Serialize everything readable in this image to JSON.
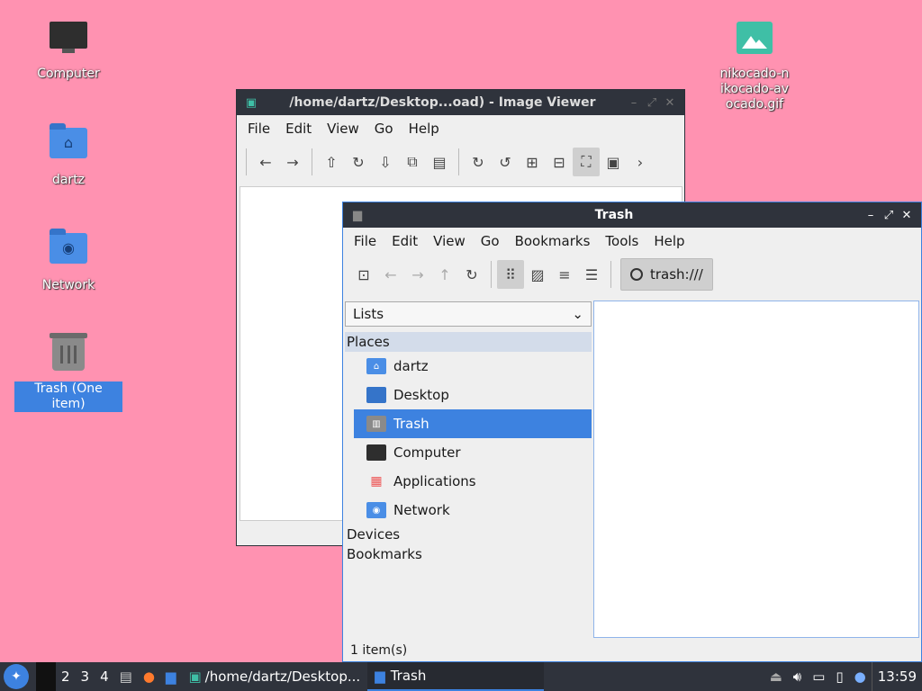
{
  "desktop": {
    "icons": [
      {
        "label": "Computer"
      },
      {
        "label": "dartz"
      },
      {
        "label": "Network"
      },
      {
        "label": "Trash (One item)"
      },
      {
        "label": "nikocado-nikocado-avocado.gif"
      }
    ]
  },
  "viewer": {
    "title": "/home/dartz/Desktop...oad) - Image Viewer",
    "menu": [
      "File",
      "Edit",
      "View",
      "Go",
      "Help"
    ]
  },
  "trash": {
    "title": "Trash",
    "menu": [
      "File",
      "Edit",
      "View",
      "Go",
      "Bookmarks",
      "Tools",
      "Help"
    ],
    "location": "trash:///",
    "side_mode": "Lists",
    "groups": {
      "places": "Places",
      "devices": "Devices",
      "bookmarks": "Bookmarks"
    },
    "places": [
      "dartz",
      "Desktop",
      "Trash",
      "Computer",
      "Applications",
      "Network"
    ],
    "status": "1 item(s)"
  },
  "taskbar": {
    "workspaces": [
      "2",
      "3",
      "4"
    ],
    "tasks": [
      "/home/dartz/Desktop...",
      "Trash"
    ],
    "clock": "13:59"
  },
  "colors": {
    "desktop_bg": "#ff92b1",
    "accent": "#3d82e0",
    "panel": "#2f333c"
  }
}
